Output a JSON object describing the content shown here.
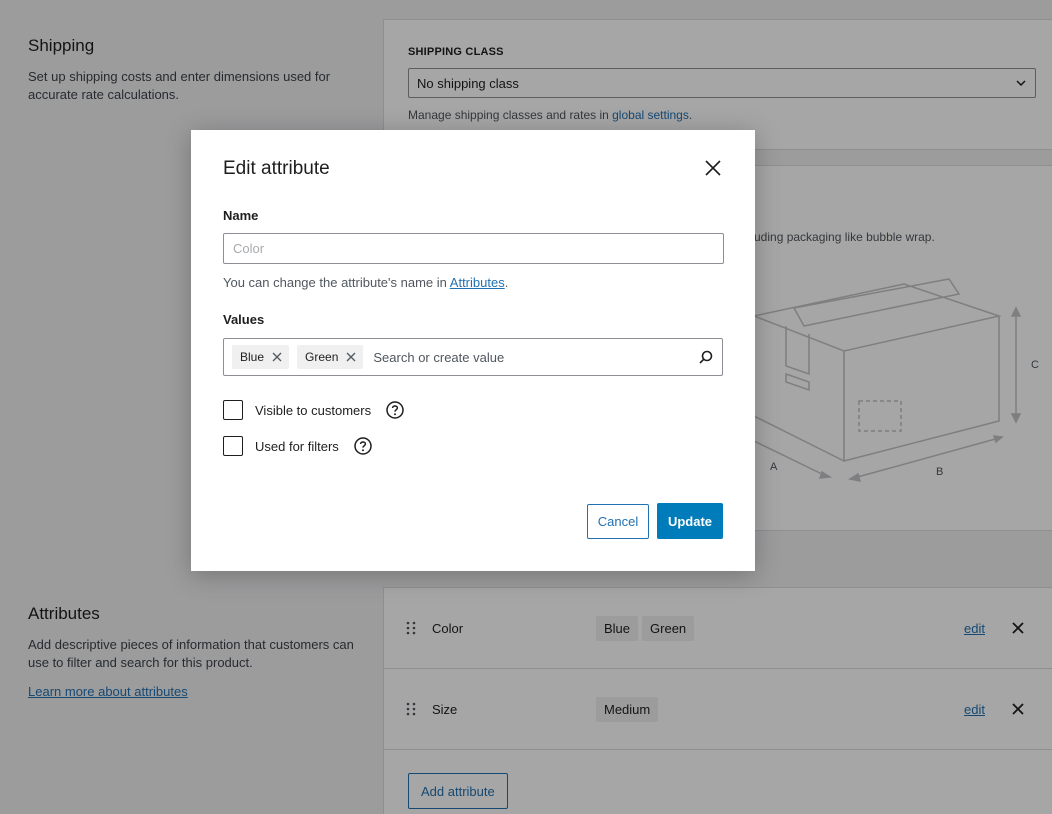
{
  "shipping": {
    "title": "Shipping",
    "description": "Set up shipping costs and enter dimensions used for accurate rate calculations.",
    "class_label": "SHIPPING CLASS",
    "class_value": "No shipping class",
    "help_prefix": "Manage shipping classes and rates in ",
    "help_link": "global settings",
    "help_suffix": "."
  },
  "dimensions": {
    "partial_text": "uding packaging like bubble wrap.",
    "labels": {
      "a": "A",
      "b": "B",
      "c": "C"
    }
  },
  "attributes_section": {
    "title": "Attributes",
    "description": "Add descriptive pieces of information that customers can use to filter and search for this product.",
    "learn_more": "Learn more about attributes",
    "rows": [
      {
        "name": "Color",
        "values": [
          "Blue",
          "Green"
        ],
        "edit": "edit"
      },
      {
        "name": "Size",
        "values": [
          "Medium"
        ],
        "edit": "edit"
      }
    ],
    "add_button": "Add attribute"
  },
  "modal": {
    "title": "Edit attribute",
    "name_label": "Name",
    "name_placeholder": "Color",
    "hint_prefix": "You can change the attribute's name in ",
    "hint_link": "Attributes",
    "hint_suffix": ".",
    "values_label": "Values",
    "value_chips": [
      "Blue",
      "Green"
    ],
    "values_placeholder": "Search or create value",
    "visible_label": "Visible to customers",
    "filters_label": "Used for filters",
    "cancel": "Cancel",
    "update": "Update"
  },
  "colors": {
    "accent": "#2271b1",
    "primary_button": "#007cba"
  }
}
